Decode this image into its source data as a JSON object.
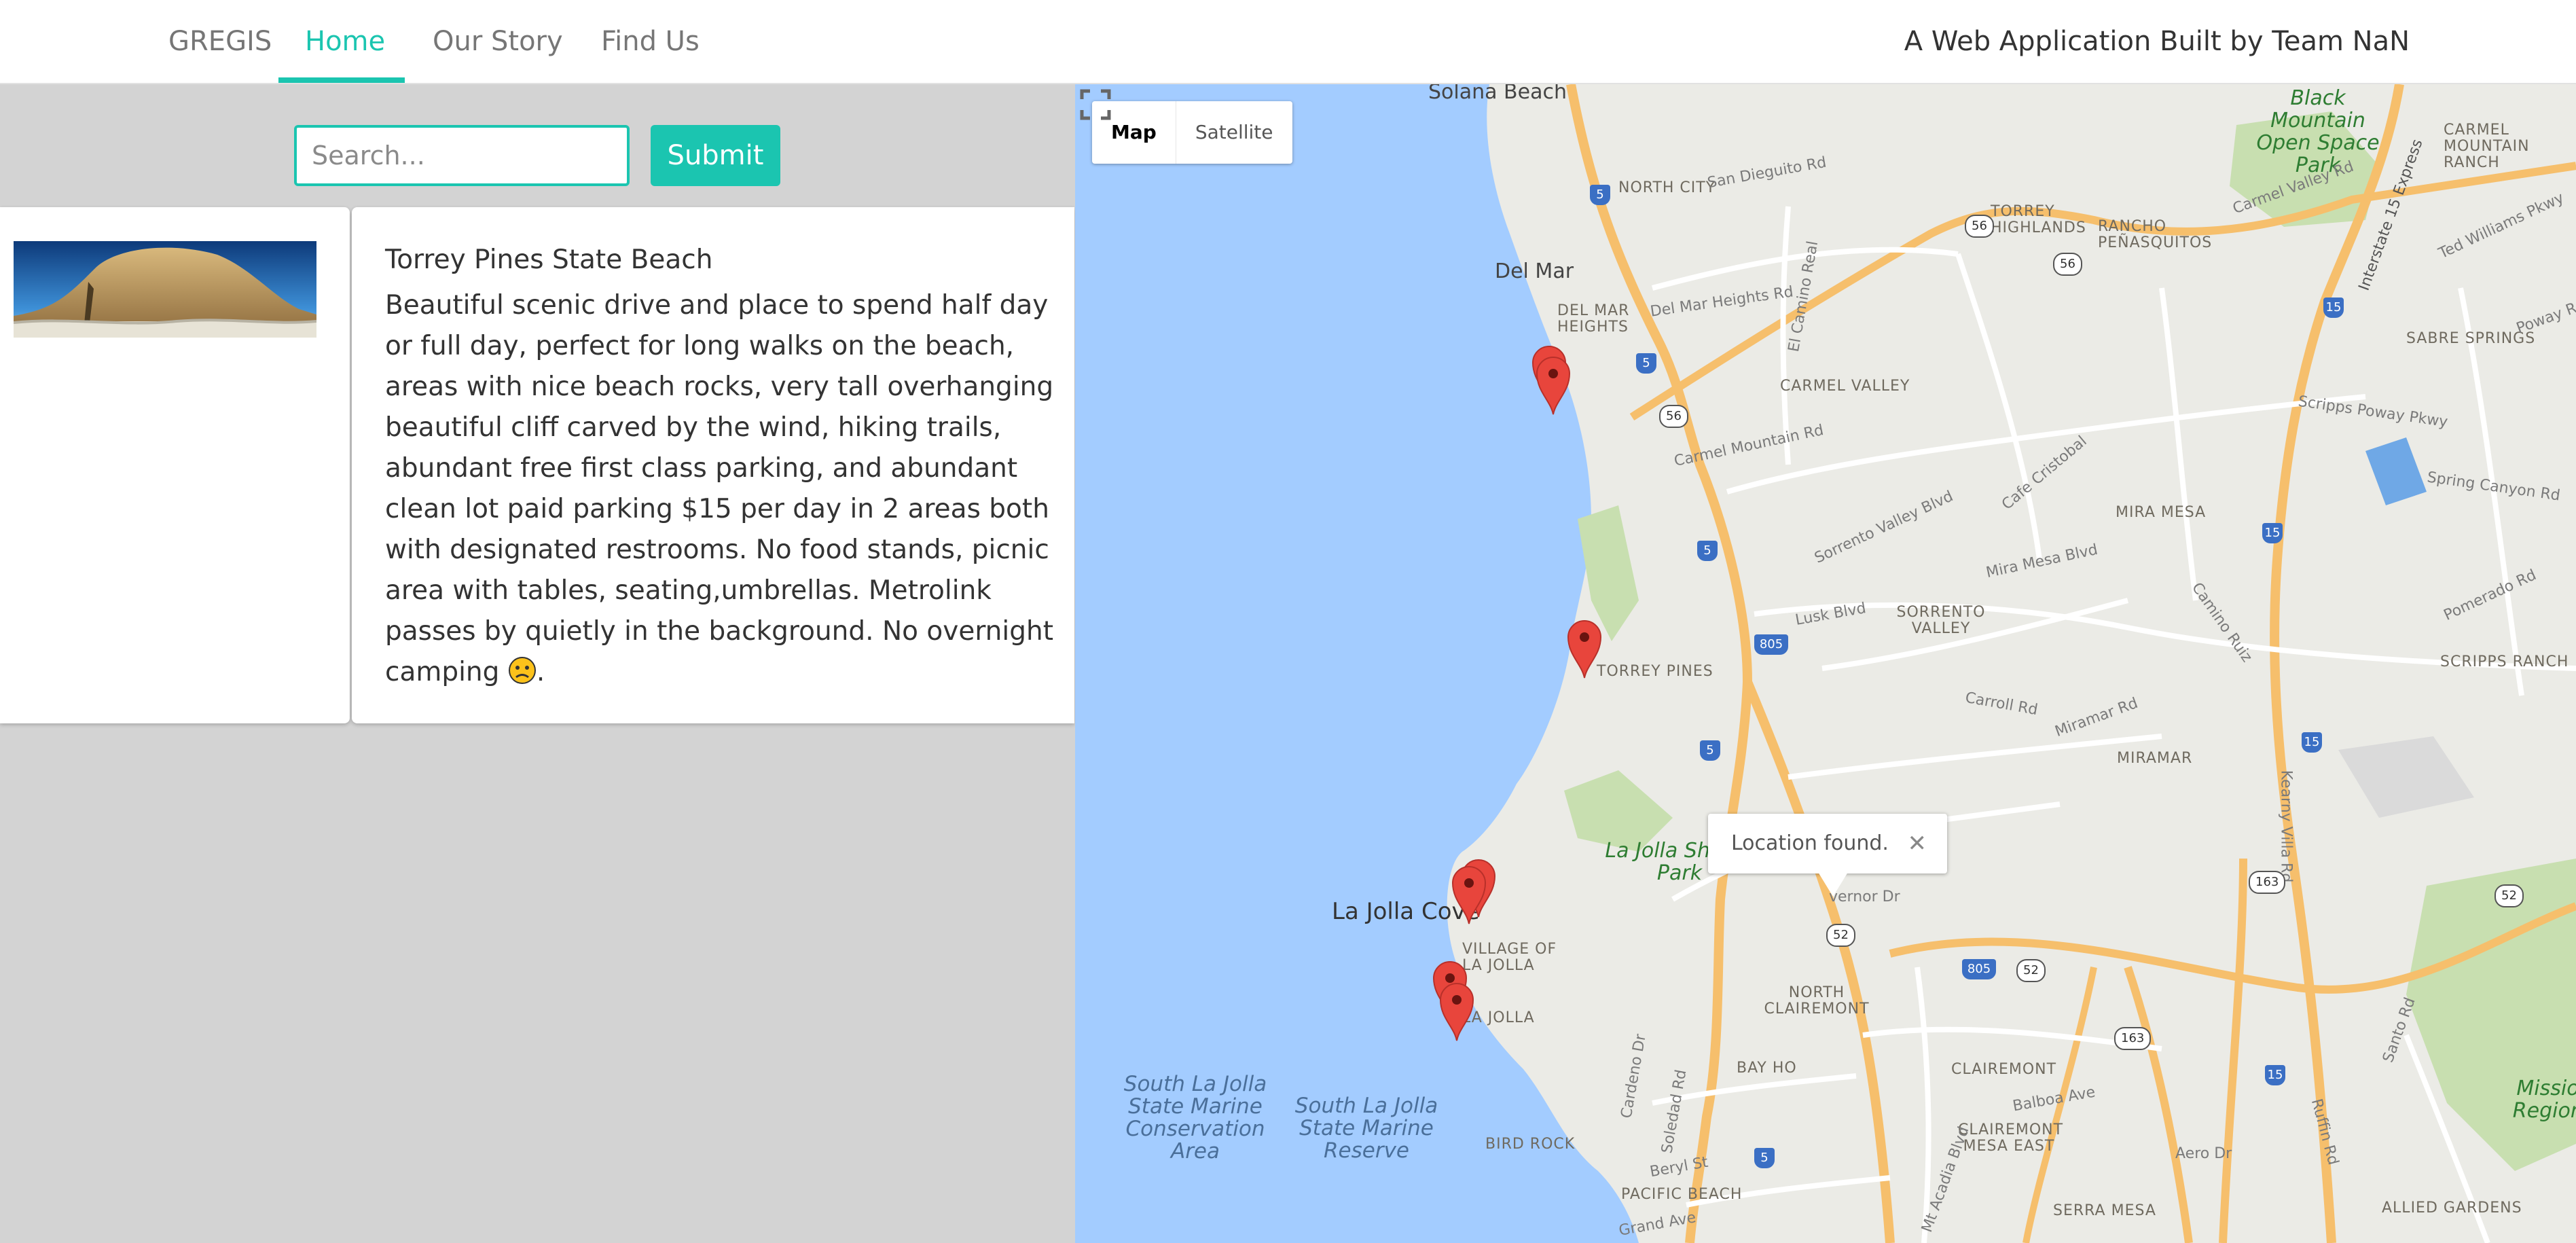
{
  "nav": {
    "brand": "GREGIS",
    "items": [
      {
        "label": "Home",
        "active": true
      },
      {
        "label": "Our Story",
        "active": false
      },
      {
        "label": "Find Us",
        "active": false
      }
    ],
    "tagline": "A Web Application Built by Team NaN"
  },
  "search": {
    "placeholder": "Search...",
    "value": "",
    "submit_label": "Submit"
  },
  "result": {
    "image_icon": "landscape-photo",
    "title": "Torrey Pines State Beach",
    "description": "Beautiful scenic drive and place to spend half day or full day, perfect for long walks on the beach, areas with nice beach rocks, very tall overhanging beautiful cliff carved by the wind, hiking trails, abundant free first class parking, and abundant clean lot paid parking $15 per day in 2 areas both with designated restrooms. No food stands, picnic area with tables, seating,umbrellas. Metrolink passes by quietly in the background. No overnight camping",
    "description_end": ".",
    "emoji_icon": "frowning-face-emoji"
  },
  "map": {
    "type_buttons": [
      {
        "label": "Map",
        "selected": true
      },
      {
        "label": "Satellite",
        "selected": false
      }
    ],
    "info_window": {
      "text": "Location found.",
      "close_symbol": "✕"
    },
    "labels": {
      "solana_beach": "Solana Beach",
      "north_city": "NORTH CITY",
      "del_mar": "Del Mar",
      "del_mar_heights": "DEL MAR HEIGHTS",
      "carmel_valley": "CARMEL VALLEY",
      "torrey_highlands": "TORREY HIGHLANDS",
      "rancho_penasquitos": "RANCHO PEÑASQUITOS",
      "black_mountain": "Black Mountain Open Space Park",
      "carmel_mountain_ranch": "CARMEL MOUNTAIN RANCH",
      "sabre_springs": "SABRE SPRINGS",
      "mira_mesa": "MIRA MESA",
      "sorrento_valley": "SORRENTO VALLEY",
      "torrey_pines": "TORREY PINES",
      "scripps_ranch": "SCRIPPS RANCH",
      "miramar": "MIRAMAR",
      "la_jolla_shores_park": "La Jolla Shores Park",
      "la_jolla_cove": "La Jolla Cove",
      "village_of_la_jolla": "VILLAGE OF LA JOLLA",
      "la_jolla": "LA JOLLA",
      "north_clairemont": "NORTH CLAIREMONT",
      "clairemont": "CLAIREMONT",
      "clairemont_mesa_east": "CLAIREMONT MESA EAST",
      "bay_ho": "BAY HO",
      "bird_rock": "BIRD ROCK",
      "pacific_beach": "PACIFIC BEACH",
      "serra_mesa": "SERRA MESA",
      "allied_gardens": "ALLIED GARDENS",
      "mission_regional": "Mission Regiona",
      "south_lj_conservation": "South La Jolla State Marine Conservation Area",
      "south_lj_reserve": "South La Jolla State Marine Reserve",
      "roads": {
        "san_dieguito": "San Dieguito Rd",
        "del_mar_heights_rd": "Del Mar Heights Rd",
        "el_camino_real": "El Camino Real",
        "carmel_mountain_rd": "Carmel Mountain Rd",
        "sorrento_valley_blvd": "Sorrento Valley Blvd",
        "mira_mesa_blvd": "Mira Mesa Blvd",
        "lusk_blvd": "Lusk Blvd",
        "carroll_rd": "Carroll Rd",
        "miramar_rd": "Miramar Rd",
        "camino_ruiz": "Camino Ruiz",
        "pomerado_rd": "Pomerado Rd",
        "spring_canyon_rd": "Spring Canyon Rd",
        "scripps_poway_pkwy": "Scripps Poway Pkwy",
        "ted_williams_pkwy": "Ted Williams Pkwy",
        "poway_rd": "Poway Rd",
        "carmel_valley_rd": "Carmel Valley Rd",
        "interstate_15_express": "Interstate 15 Express",
        "kearny_villa_rd": "Kearny Villa Rd",
        "cafe_cristobal": "Cafe Cristobal",
        "balboa_ave": "Balboa Ave",
        "cardeno_dr": "Cardeno Dr",
        "soledad_rd": "Soledad Rd",
        "beryl_st": "Beryl St",
        "grand_ave": "Grand Ave",
        "ruffin_rd": "Ruffin Rd",
        "santo_rd": "Santo Rd",
        "aero_dr": "Aero Dr",
        "mt_acadia_blvd": "Mt Acadia Blvd",
        "governor_dr": "vernor Dr"
      }
    },
    "shields": [
      "5",
      "56",
      "15",
      "805",
      "52",
      "163"
    ],
    "pins": 7
  },
  "colors": {
    "accent": "#1bc5b0",
    "ocean": "#a3ccff",
    "land": "#ebebe6",
    "highway": "#f6bf6c",
    "pin": "#e8453c"
  }
}
